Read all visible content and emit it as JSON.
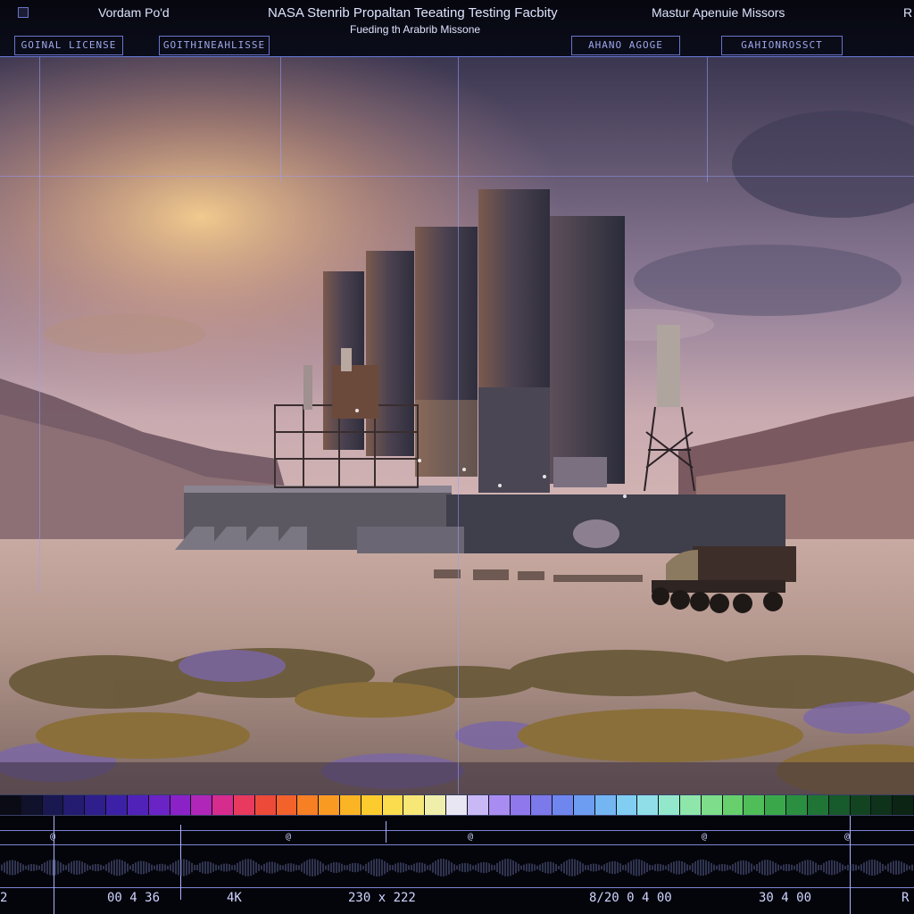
{
  "header": {
    "left_title": "Vordam Po'd",
    "center_title": "NASA Stenrib Propaltan Teeating Testing Facbity",
    "center_subtitle": "Fueding th Arabrib Missone",
    "right_title": "Mastur Apenuie Missors",
    "far_right": "R",
    "box_labels": [
      "GOINAL LICENSE",
      "GOITHINEAHLISSE",
      "AHANO AGOGE",
      "GAHIONROSSCT"
    ]
  },
  "scene": {
    "description_tags": [
      "sky-icon",
      "mountain-icon",
      "facility-icon",
      "tower-icon",
      "vehicle-icon",
      "shrub-icon"
    ],
    "colors": {
      "sky_top": "#3a3550",
      "sky_glow": "#f2c28a",
      "ground": "#b89a8e",
      "facility": "#3b3a4a",
      "accent_guides": "#969fff"
    }
  },
  "spectrum": {
    "colors": [
      "#0b0b16",
      "#10112a",
      "#1a1850",
      "#241c70",
      "#2e1f8c",
      "#3c21a6",
      "#5122b8",
      "#6a23c4",
      "#8a22c8",
      "#b026b8",
      "#d62c8e",
      "#e83a5e",
      "#ee4a3a",
      "#f3622a",
      "#f77f24",
      "#f99a22",
      "#fbb424",
      "#fccb2e",
      "#fbdc4e",
      "#f6e776",
      "#efeeaa",
      "#e8e6f2",
      "#c9b8f6",
      "#a98cf2",
      "#8f78ec",
      "#7c79ea",
      "#6f86ee",
      "#6d9df0",
      "#74b6f2",
      "#82cdf2",
      "#90dfe8",
      "#93e8cc",
      "#8fe6aa",
      "#7edd8a",
      "#67cf6c",
      "#4fbe58",
      "#3aa84a",
      "#2a8f40",
      "#1f7436",
      "#175a2c",
      "#124422",
      "#0e321a",
      "#0b2414"
    ]
  },
  "bottom": {
    "readouts": [
      "2",
      "00 4 36",
      "4K",
      "230 x 222",
      "8/20 0 4 00",
      "30 4 00",
      "R"
    ]
  }
}
